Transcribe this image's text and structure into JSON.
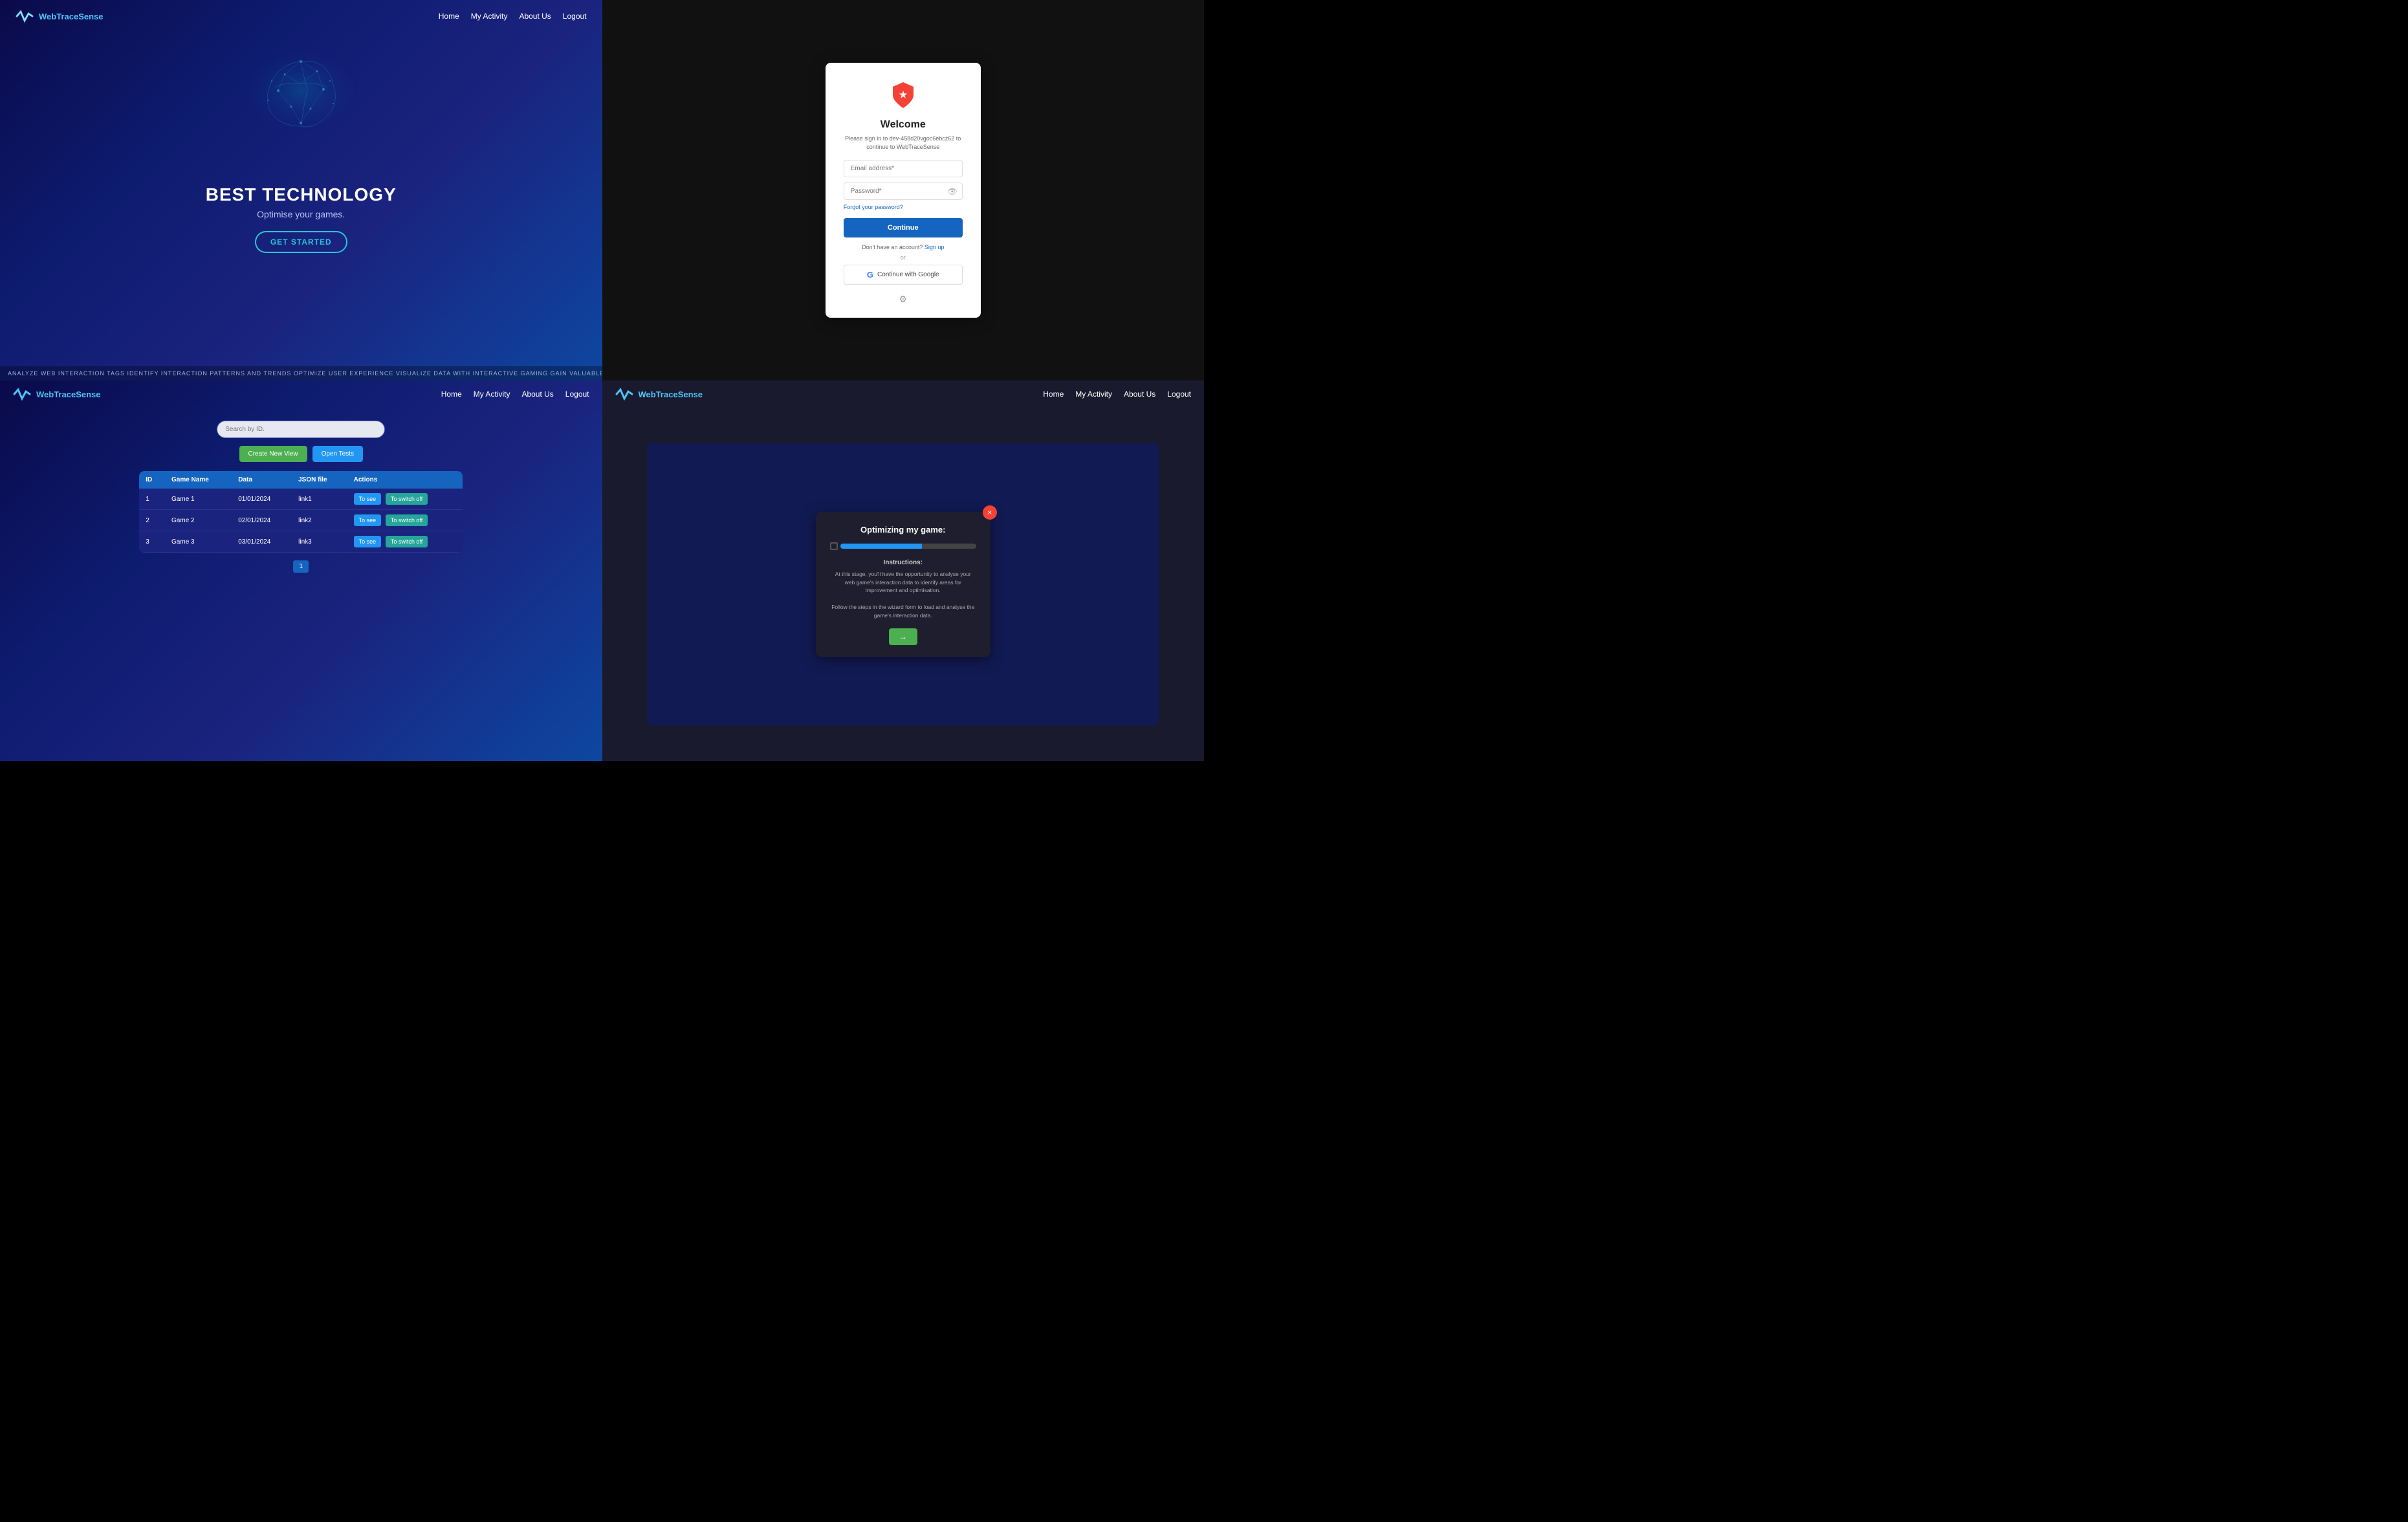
{
  "hero": {
    "logo_text_main": "WebTraceSense",
    "logo_text_color": "WebTrace",
    "logo_text_accent": "Sense",
    "nav": {
      "home": "Home",
      "activity": "My Activity",
      "about": "About Us",
      "logout": "Logout"
    },
    "title": "BEST TECHNOLOGY",
    "subtitle": "Optimise your games.",
    "cta_button": "GET STARTED",
    "ticker": "ANALYZE WEB INTERACTION TAGS   IDENTIFY INTERACTION PATTERNS AND TRENDS   OPTIMIZE USER EXPERIENCE   VISUALIZE DATA WITH INTERACTIVE GAMING   GAIN VALUABLE INSIGHTS   SECURE AND"
  },
  "login": {
    "welcome_title": "Welcome",
    "subtitle": "Please sign in to dev-458d20vgoc6ebcz62 to continue to WebTraceSense",
    "email_placeholder": "Email address*",
    "password_placeholder": "Password*",
    "forgot_password": "Forgot your password?",
    "continue_button": "Continue",
    "no_account": "Don't have an account?",
    "sign_up": "Sign up",
    "or_text": "or",
    "google_button": "Continue with Google"
  },
  "dashboard": {
    "logo_text": "WebTraceSense",
    "nav": {
      "home": "Home",
      "activity": "My Activity",
      "about": "About Us",
      "logout": "Logout"
    },
    "search_placeholder": "Search by ID.",
    "create_button": "Create New View",
    "open_tests_button": "Open Tests",
    "table": {
      "headers": [
        "ID",
        "Game Name",
        "Data",
        "JSON file",
        "Actions"
      ],
      "rows": [
        {
          "id": "1",
          "name": "Game 1",
          "data": "01/01/2024",
          "json": "link1"
        },
        {
          "id": "2",
          "name": "Game 2",
          "data": "02/01/2024",
          "json": "link2"
        },
        {
          "id": "3",
          "name": "Game 3",
          "data": "03/01/2024",
          "json": "link3"
        }
      ],
      "btn_see": "To see",
      "btn_switch": "To switch off"
    },
    "pagination": "1"
  },
  "wizard": {
    "logo_text": "WebTraceSense",
    "nav": {
      "home": "Home",
      "activity": "My Activity",
      "about": "About Us",
      "logout": "Logout"
    },
    "modal": {
      "title": "Optimizing my game:",
      "instructions_title": "Instructions:",
      "instructions_text": "At this stage, you'll have the opportunity to analyse your web game's interaction data to identify areas for improvement and optimisation.\n\nFollow the steps in the wizard form to load and analyse the game's interaction data.",
      "next_button": "→"
    }
  }
}
